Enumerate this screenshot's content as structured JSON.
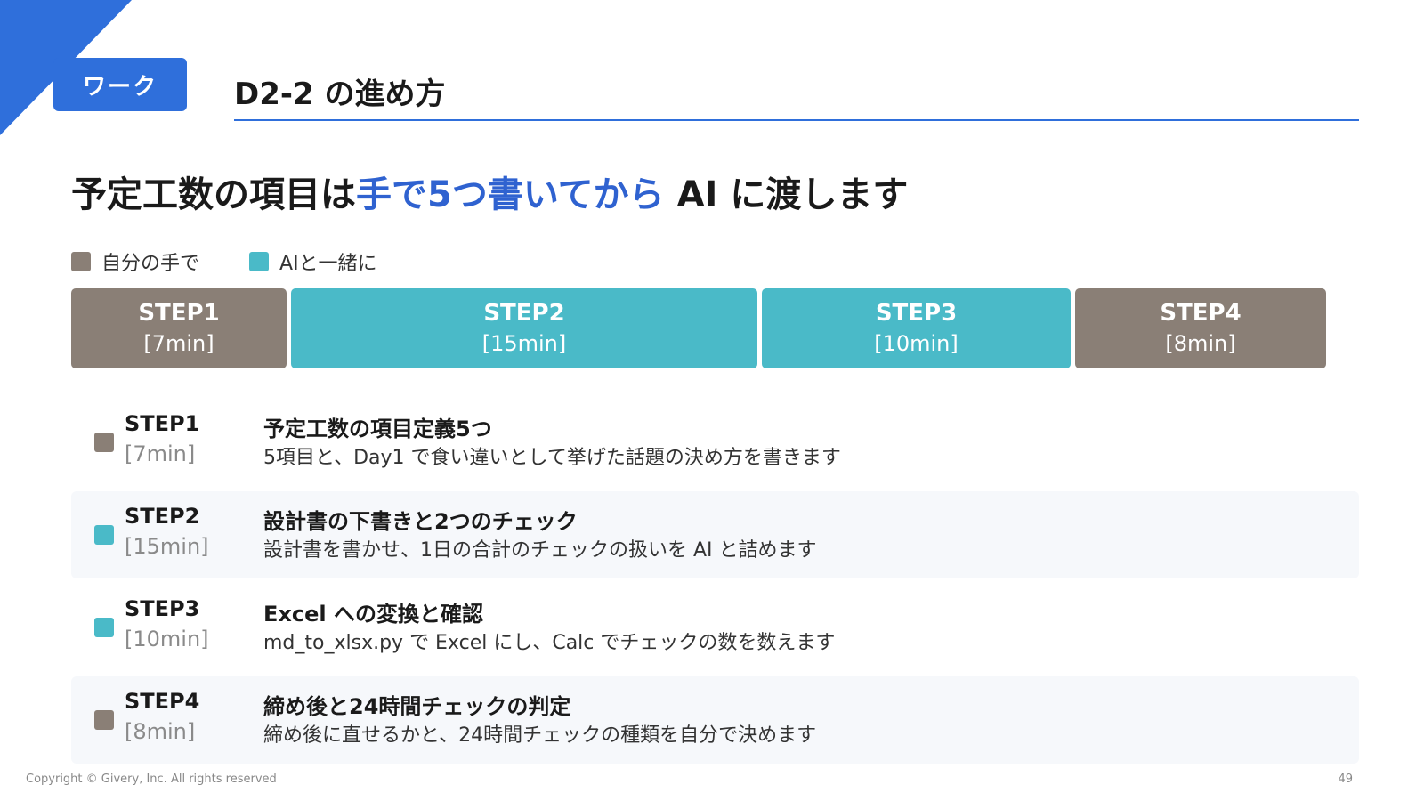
{
  "colors": {
    "primary": "#2f6fdb",
    "self": "#8a7f76",
    "ai": "#4abac8"
  },
  "tag": "ワーク",
  "header_title": "D2-2 の進め方",
  "headline": {
    "prefix": "予定工数の項目は",
    "accent": "手で5つ書いてから",
    "suffix": " AI に渡します"
  },
  "legend": [
    {
      "label": "自分の手で",
      "kind": "self"
    },
    {
      "label": "AIと一緒に",
      "kind": "ai"
    }
  ],
  "timeline": [
    {
      "name": "STEP1",
      "duration": "[7min]",
      "minutes": 7,
      "kind": "self"
    },
    {
      "name": "STEP2",
      "duration": "[15min]",
      "minutes": 15,
      "kind": "ai"
    },
    {
      "name": "STEP3",
      "duration": "[10min]",
      "minutes": 10,
      "kind": "ai"
    },
    {
      "name": "STEP4",
      "duration": "[8min]",
      "minutes": 8,
      "kind": "self"
    }
  ],
  "steps": [
    {
      "name": "STEP1",
      "duration": "[7min]",
      "title": "予定工数の項目定義5つ",
      "desc": "5項目と、Day1 で食い違いとして挙げた話題の決め方を書きます",
      "kind": "self"
    },
    {
      "name": "STEP2",
      "duration": "[15min]",
      "title": "設計書の下書きと2つのチェック",
      "desc": "設計書を書かせ、1日の合計のチェックの扱いを AI と詰めます",
      "kind": "ai"
    },
    {
      "name": "STEP3",
      "duration": "[10min]",
      "title": "Excel への変換と確認",
      "desc": "md_to_xlsx.py で Excel にし、Calc でチェックの数を数えます",
      "kind": "ai"
    },
    {
      "name": "STEP4",
      "duration": "[8min]",
      "title": "締め後と24時間チェックの判定",
      "desc": "締め後に直せるかと、24時間チェックの種類を自分で決めます",
      "kind": "self"
    }
  ],
  "footer": {
    "copyright": "Copyright © Givery, Inc. All rights reserved",
    "page": "49"
  }
}
